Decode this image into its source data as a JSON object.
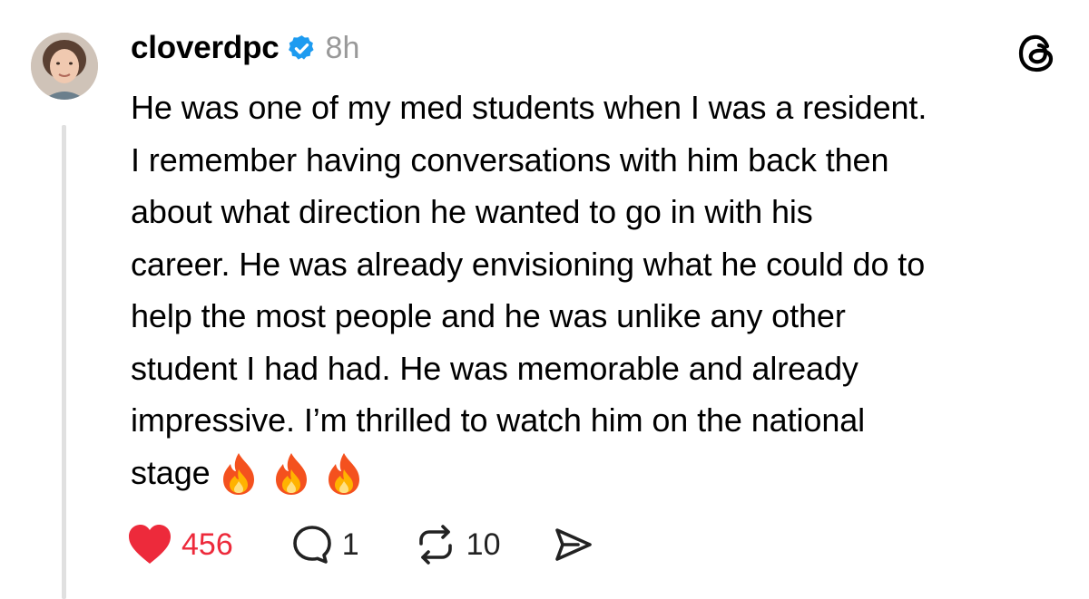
{
  "post": {
    "username": "cloverdpc",
    "verified_icon": "verified-badge-icon",
    "timestamp": "8h",
    "app_logo_icon": "threads-logo-icon",
    "text_lines": [
      "He was one of my med students when I was a resident.",
      "I remember having conversations with him back then",
      "about what direction he wanted to go in with his",
      "career. He was already envisioning what he could do to",
      "help the most people and he was unlike any other",
      "student I had had. He was memorable and already",
      "impressive. I’m thrilled to watch him on the national",
      "stage"
    ],
    "emoji": [
      "fire-emoji",
      "fire-emoji",
      "fire-emoji"
    ]
  },
  "actions": {
    "like_count": "456",
    "reply_count": "1",
    "repost_count": "10"
  },
  "colors": {
    "like_red": "#ed2a3b",
    "verified_blue": "#1d9bf0",
    "timestamp_gray": "#999999",
    "thread_line": "#e0e0e0"
  }
}
